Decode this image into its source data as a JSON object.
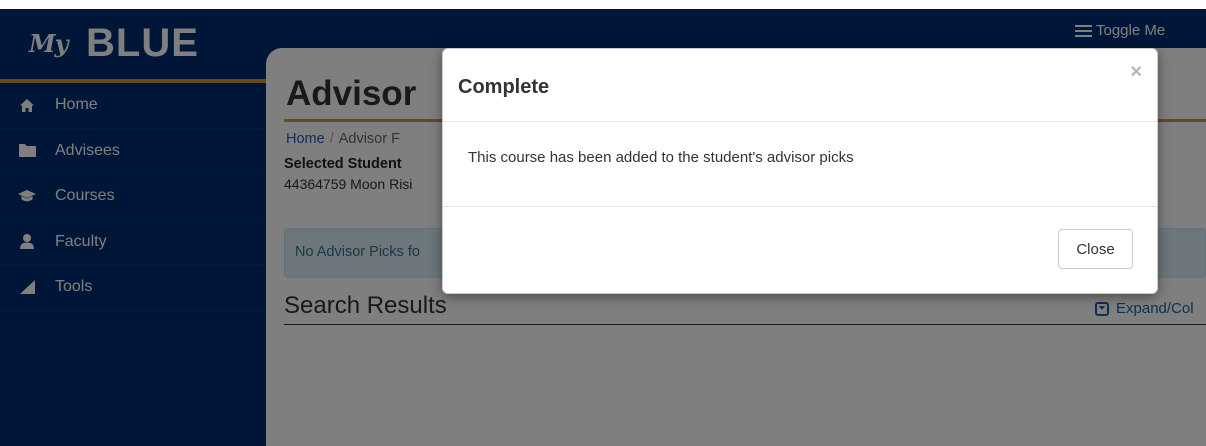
{
  "header": {
    "logo_my": "My",
    "logo_blue": "BLUE",
    "toggle_menu_label": "Toggle Me"
  },
  "sidebar": {
    "items": [
      {
        "label": "Home",
        "icon": "home-icon"
      },
      {
        "label": "Advisees",
        "icon": "folder-icon"
      },
      {
        "label": "Courses",
        "icon": "graduation-cap-icon"
      },
      {
        "label": "Faculty",
        "icon": "user-icon"
      },
      {
        "label": "Tools",
        "icon": "tools-icon"
      }
    ]
  },
  "main": {
    "page_title": "Advisor",
    "breadcrumb": {
      "home": "Home",
      "separator": "/",
      "current": "Advisor F"
    },
    "selected_student_label": "Selected Student",
    "selected_student_value": "44364759 Moon  Risi",
    "alert_text": "No Advisor Picks fo",
    "search_results_heading": "Search Results",
    "expand_label": "Expand/Col"
  },
  "modal": {
    "title": "Complete",
    "close_x": "×",
    "message": "This course has been added to the student's advisor picks",
    "close_button": "Close"
  },
  "colors": {
    "brand_navy": "#002d72",
    "accent_gold": "#c99a2e",
    "link_blue": "#1d5fa8",
    "alert_bg": "#d9edf7"
  }
}
